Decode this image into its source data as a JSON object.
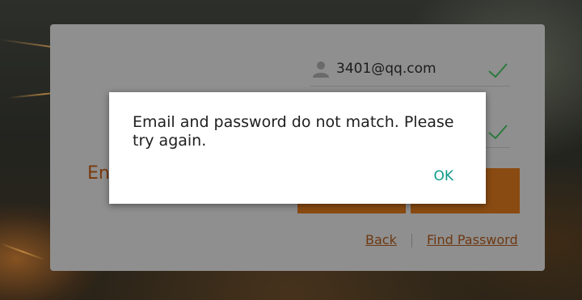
{
  "login": {
    "email_value": "3401@qq.com",
    "partial_label": "En",
    "back_link": "Back",
    "find_password_link": "Find Password"
  },
  "dialog": {
    "message": "Email and password do not match. Please try again.",
    "ok_label": "OK"
  },
  "colors": {
    "accent_orange": "#e07b20",
    "check_green": "#2fa84f",
    "ok_teal": "#16a596",
    "link_orange": "#c0611f"
  },
  "icons": {
    "user": "user-icon",
    "check": "check-icon"
  }
}
